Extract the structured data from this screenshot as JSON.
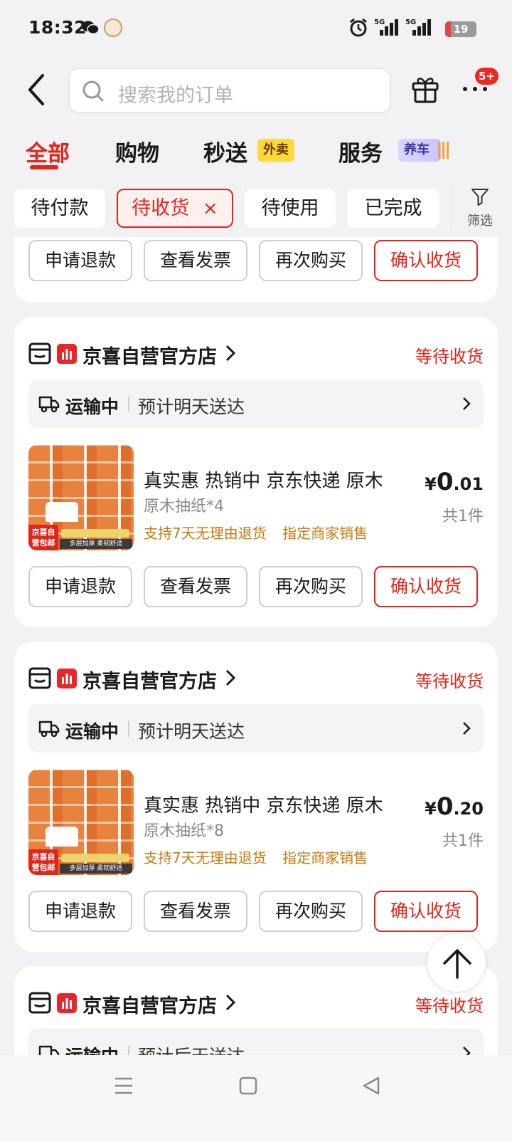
{
  "status_bar": {
    "time": "18:32",
    "network1": "5G",
    "network2": "5G",
    "battery": "19",
    "battery_level": 0.19
  },
  "header": {
    "search_placeholder": "搜索我的订单",
    "more_badge": "5+"
  },
  "tabs": [
    {
      "label": "全部",
      "active": true
    },
    {
      "label": "购物",
      "active": false
    },
    {
      "label": "秒送",
      "tag": "外卖",
      "active": false
    },
    {
      "label": "服务",
      "tag": "养车",
      "active": false
    }
  ],
  "chips": [
    {
      "label": "待付款"
    },
    {
      "label": "待收货",
      "close": "×",
      "active": true
    },
    {
      "label": "待使用"
    },
    {
      "label": "已完成"
    }
  ],
  "filter": {
    "label": "筛选"
  },
  "buttons": {
    "refund": "申请退款",
    "invoice": "查看发票",
    "rebuy": "再次购买",
    "confirm": "确认收货"
  },
  "orders": [
    {
      "store": "京喜自营官方店",
      "status": "等待收货",
      "shipping_state": "运输中",
      "shipping_eta": "预计明天送达",
      "title": "真实惠 热销中 京东快递 原木",
      "subtitle": "原木抽纸*4",
      "tags": [
        "支持7天无理由退货",
        "指定商家销售"
      ],
      "price_yen": "¥",
      "price_int": "0",
      "price_dec": ".01",
      "qty": "共1件",
      "img_tag": "京喜自营包邮",
      "img_strip": "多层加厚 柔韧舒适"
    },
    {
      "store": "京喜自营官方店",
      "status": "等待收货",
      "shipping_state": "运输中",
      "shipping_eta": "预计明天送达",
      "title": "真实惠 热销中 京东快递 原木",
      "subtitle": "原木抽纸*8",
      "tags": [
        "支持7天无理由退货",
        "指定商家销售"
      ],
      "price_yen": "¥",
      "price_int": "0",
      "price_dec": ".20",
      "qty": "共1件",
      "img_tag": "京喜自营包邮",
      "img_strip": "多层加厚 柔韧舒适"
    },
    {
      "store": "京喜自营官方店",
      "status": "等待收货",
      "shipping_state": "运输中",
      "shipping_eta": "预计后天送达"
    }
  ]
}
